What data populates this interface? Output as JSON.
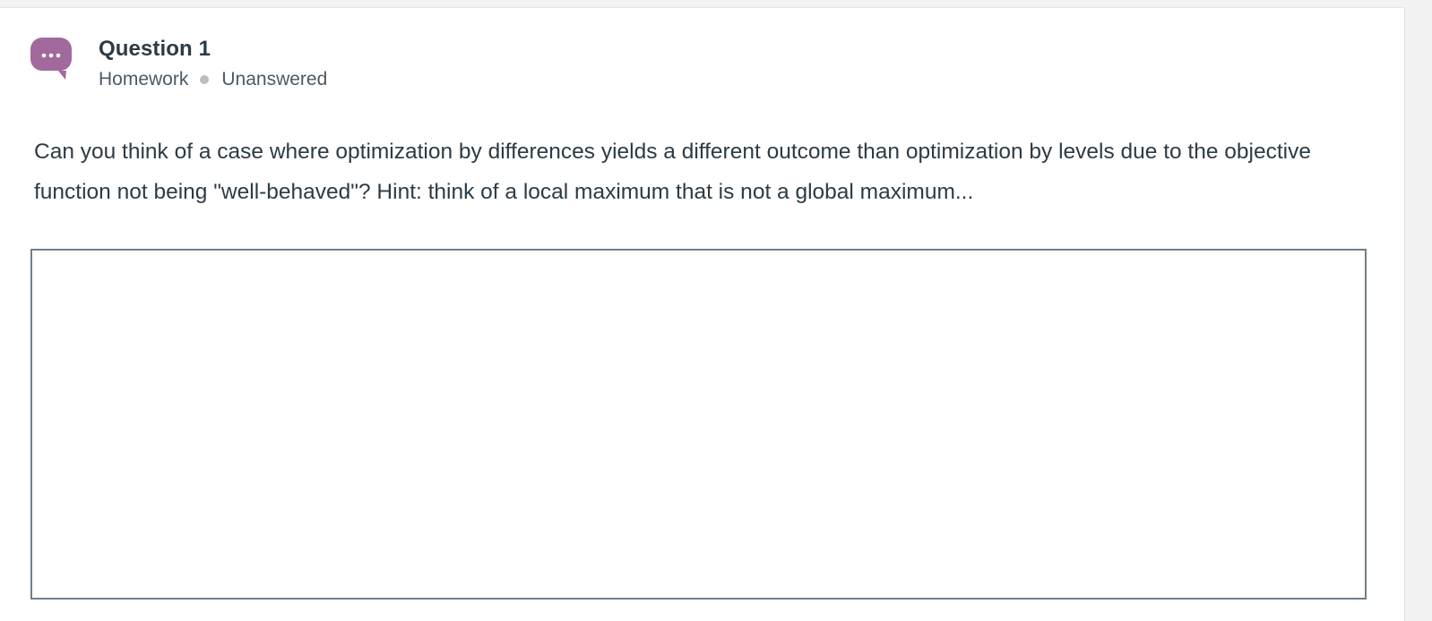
{
  "question": {
    "badge_icon": "speech-bubble-ellipsis-icon",
    "badge_color": "#a26a9c",
    "title": "Question 1",
    "category": "Homework",
    "status": "Unanswered",
    "prompt": "Can you think of a case where optimization by differences yields a different outcome than optimization by levels due to the objective function not being \"well-behaved\"? Hint: think of a local maximum that is not a global maximum...",
    "answer": {
      "value": "",
      "placeholder": ""
    }
  },
  "colors": {
    "text": "#2d3b45",
    "meta_text": "#4b5a66",
    "separator_dot": "#b8bec3",
    "input_border": "#6f7f8c"
  }
}
